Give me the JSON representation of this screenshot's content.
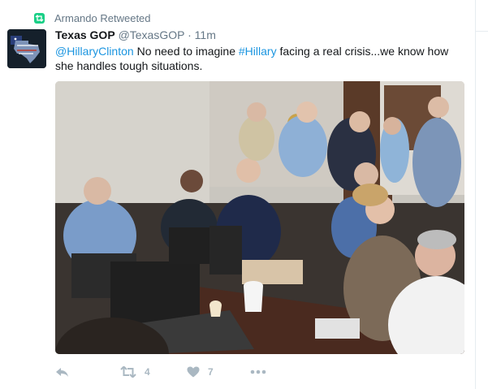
{
  "retweet_context": {
    "label": "Armando Retweeted",
    "icon": "retweet-icon"
  },
  "tweet": {
    "author_name": "Texas GOP",
    "author_handle": "@TexasGOP",
    "separator": "·",
    "time": "11m",
    "text_segments": [
      {
        "text": "@HillaryClinton",
        "type": "mention"
      },
      {
        "text": " No need to imagine ",
        "type": "plain"
      },
      {
        "text": "#Hillary",
        "type": "hashtag"
      },
      {
        "text": " facing a real crisis...we know how she handles tough situations.",
        "type": "plain"
      }
    ],
    "media": {
      "icon": "photo"
    }
  },
  "actions": {
    "reply": {
      "icon": "reply-icon"
    },
    "retweet": {
      "icon": "retweet-icon",
      "count": "4"
    },
    "like": {
      "icon": "heart-icon",
      "count": "7"
    },
    "more": {
      "icon": "more-icon"
    }
  },
  "colors": {
    "link": "#1b95e0",
    "retweet_badge": "#19cf86",
    "muted": "#657786",
    "action_icon": "#aab8c2"
  }
}
